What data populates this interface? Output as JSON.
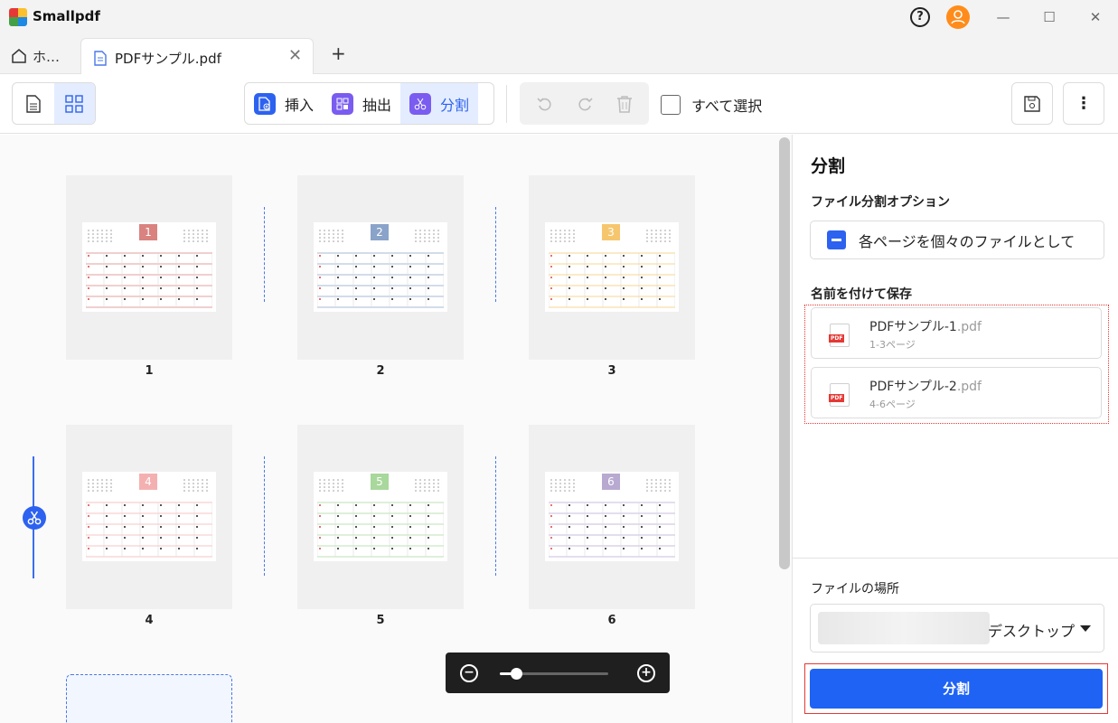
{
  "app": {
    "name": "Smallpdf",
    "help": "?",
    "minimize": "—",
    "maximize": "☐",
    "close": "✕"
  },
  "tabs": {
    "home_label": "ホ…",
    "active_label": "PDFサンプル.pdf",
    "close": "✕",
    "add": "+"
  },
  "toolbar": {
    "insert_label": "挿入",
    "extract_label": "抽出",
    "split_label": "分割",
    "select_all_label": "すべて選択",
    "more": "⋮"
  },
  "pages": [
    {
      "label": "1",
      "num": "1",
      "color": "#d9827f"
    },
    {
      "label": "2",
      "num": "2",
      "color": "#8aa3c9"
    },
    {
      "label": "3",
      "num": "3",
      "color": "#f6c66e"
    },
    {
      "label": "4",
      "num": "4",
      "color": "#f4b0b0"
    },
    {
      "label": "5",
      "num": "5",
      "color": "#a8d89b"
    },
    {
      "label": "6",
      "num": "6",
      "color": "#b8a9d0"
    }
  ],
  "zoom": {
    "minus": "−",
    "plus": "+",
    "level": 0.15
  },
  "panel": {
    "title": "分割",
    "option_heading": "ファイル分割オプション",
    "option_label": "各ページを個々のファイルとして",
    "save_heading": "名前を付けて保存",
    "files": [
      {
        "name": "PDFサンプル-1",
        "ext": ".pdf",
        "range": "1-3ページ"
      },
      {
        "name": "PDFサンプル-2",
        "ext": ".pdf",
        "range": "4-6ページ"
      }
    ],
    "location_heading": "ファイルの場所",
    "location_value": "デスクトップ",
    "split_button": "分割"
  },
  "colors": {
    "accent": "#2d62f0",
    "highlight": "#e53935"
  }
}
